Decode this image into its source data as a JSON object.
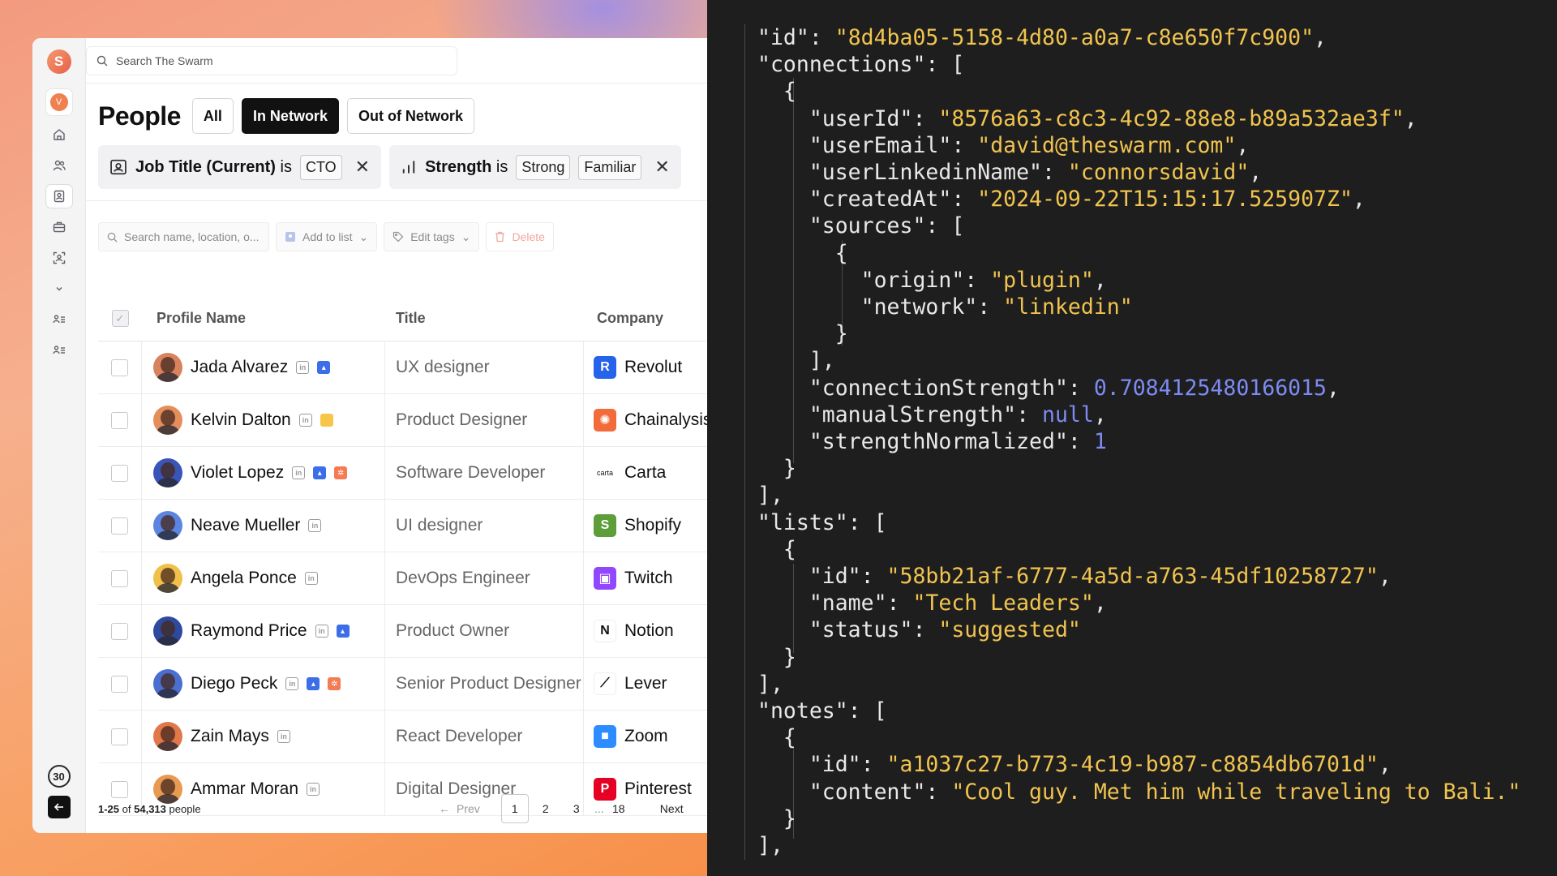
{
  "search": {
    "placeholder": "Search The Swarm"
  },
  "sidebar": {
    "logo_letter": "S",
    "user_initial": "V",
    "counter": "30"
  },
  "header": {
    "title": "People",
    "tabs": [
      {
        "label": "All",
        "active": false
      },
      {
        "label": "In Network",
        "active": true
      },
      {
        "label": "Out of Network",
        "active": false
      }
    ]
  },
  "filters": [
    {
      "field": "Job Title (Current)",
      "operator": "is",
      "values": [
        "CTO"
      ]
    },
    {
      "field": "Strength",
      "operator": "is",
      "values": [
        "Strong",
        "Familiar"
      ]
    }
  ],
  "toolbar": {
    "search_placeholder": "Search name, location, o...",
    "add_to_list": "Add to list",
    "edit_tags": "Edit tags",
    "delete": "Delete"
  },
  "table": {
    "columns": [
      "Profile Name",
      "Title",
      "Company"
    ],
    "rows": [
      {
        "name": "Jada Alvarez",
        "title": "UX designer",
        "company": "Revolut",
        "badges": [
          "linkedin",
          "contact"
        ],
        "avatar_color": "#d9825e",
        "logo_color": "#2563eb",
        "logo_text": "R"
      },
      {
        "name": "Kelvin Dalton",
        "title": "Product Designer",
        "company": "Chainalysis",
        "badges": [
          "linkedin",
          "note"
        ],
        "avatar_color": "#e48e5c",
        "logo_color": "#f26b3a",
        "logo_text": "✺"
      },
      {
        "name": "Violet Lopez",
        "title": "Software Developer",
        "company": "Carta",
        "badges": [
          "linkedin",
          "contact",
          "hubspot"
        ],
        "avatar_color": "#3a55b8",
        "logo_color": "#ffffff",
        "logo_text": "carta"
      },
      {
        "name": "Neave Mueller",
        "title": "UI designer",
        "company": "Shopify",
        "badges": [
          "linkedin"
        ],
        "avatar_color": "#5b85e0",
        "logo_color": "#5e9e3a",
        "logo_text": "S"
      },
      {
        "name": "Angela Ponce",
        "title": "DevOps Engineer",
        "company": "Twitch",
        "badges": [
          "linkedin"
        ],
        "avatar_color": "#f0c04a",
        "logo_color": "#9146ff",
        "logo_text": "▣"
      },
      {
        "name": "Raymond Price",
        "title": "Product Owner",
        "company": "Notion",
        "badges": [
          "linkedin",
          "contact"
        ],
        "avatar_color": "#2e4a9e",
        "logo_color": "#ffffff",
        "logo_text": "N"
      },
      {
        "name": "Diego Peck",
        "title": "Senior Product Designer",
        "company": "Lever",
        "badges": [
          "linkedin",
          "contact",
          "hubspot"
        ],
        "avatar_color": "#4a6fd0",
        "logo_color": "#ffffff",
        "logo_text": "⟋"
      },
      {
        "name": "Zain Mays",
        "title": "React Developer",
        "company": "Zoom",
        "badges": [
          "linkedin"
        ],
        "avatar_color": "#e0784a",
        "logo_color": "#2d8cff",
        "logo_text": "■"
      },
      {
        "name": "Ammar Moran",
        "title": "Digital Designer",
        "company": "Pinterest",
        "badges": [
          "linkedin"
        ],
        "avatar_color": "#e89a52",
        "logo_color": "#e60023",
        "logo_text": "P"
      }
    ]
  },
  "footer": {
    "range": "1-25",
    "of_text": "of",
    "total": "54,313",
    "unit": "people",
    "prev": "Prev",
    "next": "Next",
    "pages": [
      "1",
      "2",
      "3",
      "...",
      "18"
    ],
    "current_page": "1"
  },
  "code_lines": [
    [
      {
        "t": "\"id\": "
      },
      {
        "t": "\"8d4ba05-5158-4d80-a0a7-c8e650f7c900\"",
        "c": "str"
      },
      {
        "t": ","
      }
    ],
    [
      {
        "t": "\"connections\": ["
      }
    ],
    [
      {
        "t": "  {"
      }
    ],
    [
      {
        "t": "    \"userId\": "
      },
      {
        "t": "\"8576a63-c8c3-4c92-88e8-b89a532ae3f\"",
        "c": "str"
      },
      {
        "t": ","
      }
    ],
    [
      {
        "t": "    \"userEmail\": "
      },
      {
        "t": "\"david@theswarm.com\"",
        "c": "str"
      },
      {
        "t": ","
      }
    ],
    [
      {
        "t": "    \"userLinkedinName\": "
      },
      {
        "t": "\"connorsdavid\"",
        "c": "str"
      },
      {
        "t": ","
      }
    ],
    [
      {
        "t": "    \"createdAt\": "
      },
      {
        "t": "\"2024-09-22T15:15:17.525907Z\"",
        "c": "str"
      },
      {
        "t": ","
      }
    ],
    [
      {
        "t": "    \"sources\": ["
      }
    ],
    [
      {
        "t": "      {"
      }
    ],
    [
      {
        "t": "        \"origin\": "
      },
      {
        "t": "\"plugin\"",
        "c": "str"
      },
      {
        "t": ","
      }
    ],
    [
      {
        "t": "        \"network\": "
      },
      {
        "t": "\"linkedin\"",
        "c": "str"
      }
    ],
    [
      {
        "t": "      }"
      }
    ],
    [
      {
        "t": "    ],"
      }
    ],
    [
      {
        "t": "    \"connectionStrength\": "
      },
      {
        "t": "0.7084125480166015",
        "c": "num"
      },
      {
        "t": ","
      }
    ],
    [
      {
        "t": "    \"manualStrength\": "
      },
      {
        "t": "null",
        "c": "num"
      },
      {
        "t": ","
      }
    ],
    [
      {
        "t": "    \"strengthNormalized\": "
      },
      {
        "t": "1",
        "c": "num"
      }
    ],
    [
      {
        "t": "  }"
      }
    ],
    [
      {
        "t": "],"
      }
    ],
    [
      {
        "t": "\"lists\": ["
      }
    ],
    [
      {
        "t": "  {"
      }
    ],
    [
      {
        "t": "    \"id\": "
      },
      {
        "t": "\"58bb21af-6777-4a5d-a763-45df10258727\"",
        "c": "str"
      },
      {
        "t": ","
      }
    ],
    [
      {
        "t": "    \"name\": "
      },
      {
        "t": "\"Tech Leaders\"",
        "c": "str"
      },
      {
        "t": ","
      }
    ],
    [
      {
        "t": "    \"status\": "
      },
      {
        "t": "\"suggested\"",
        "c": "str"
      }
    ],
    [
      {
        "t": "  }"
      }
    ],
    [
      {
        "t": "],"
      }
    ],
    [
      {
        "t": "\"notes\": ["
      }
    ],
    [
      {
        "t": "  {"
      }
    ],
    [
      {
        "t": "    \"id\": "
      },
      {
        "t": "\"a1037c27-b773-4c19-b987-c8854db6701d\"",
        "c": "str"
      },
      {
        "t": ","
      }
    ],
    [
      {
        "t": "    \"content\": "
      },
      {
        "t": "\"Cool guy. Met him while traveling to Bali.\"",
        "c": "str"
      }
    ],
    [
      {
        "t": "  }"
      }
    ],
    [
      {
        "t": "],"
      }
    ]
  ]
}
